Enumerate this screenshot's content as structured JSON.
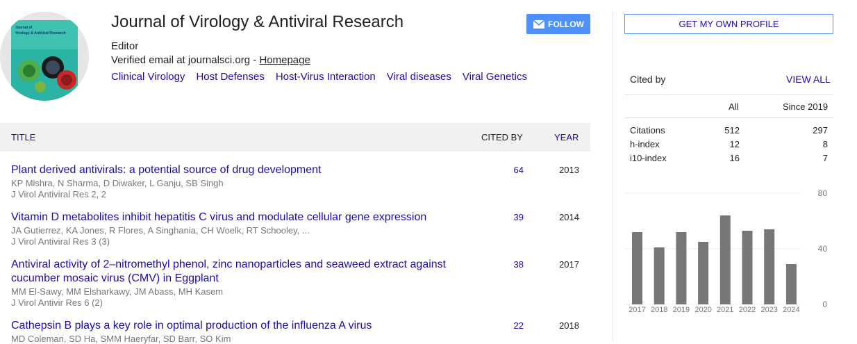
{
  "profile": {
    "name": "Journal of Virology & Antiviral Research",
    "affiliation": "Editor",
    "email_text": "Verified email at journalsci.org - ",
    "homepage_label": "Homepage",
    "interests": [
      "Clinical Virology",
      "Host Defenses",
      "Host-Virus Interaction",
      "Viral diseases",
      "Viral Genetics"
    ],
    "follow_label": "FOLLOW",
    "avatar_lines": [
      "Journal of",
      "Virology & Antiviral Research"
    ]
  },
  "table": {
    "headers": {
      "title": "TITLE",
      "cited_by": "CITED BY",
      "year": "YEAR"
    },
    "rows": [
      {
        "title": "Plant derived antivirals: a potential source of drug development",
        "authors": "KP Mishra, N Sharma, D Diwaker, L Ganju, SB Singh",
        "venue": "J Virol Antiviral Res 2, 2",
        "cited_by": "64",
        "year": "2013"
      },
      {
        "title": "Vitamin D metabolites inhibit hepatitis C virus and modulate cellular gene expression",
        "authors": "JA Gutierrez, KA Jones, R Flores, A Singhania, CH Woelk, RT Schooley, ...",
        "venue": "J Virol Antiviral Res 3 (3)",
        "cited_by": "39",
        "year": "2014"
      },
      {
        "title": "Antiviral activity of 2–nitromethyl phenol, zinc nanoparticles and seaweed extract against cucumber mosaic virus (CMV) in Eggplant",
        "authors": "MM El-Sawy, MM Elsharkawy, JM Abass, MH Kasem",
        "venue": "J Virol Antivir Res 6 (2)",
        "cited_by": "38",
        "year": "2017"
      },
      {
        "title": "Cathepsin B plays a key role in optimal production of the influenza A virus",
        "authors": "MD Coleman, SD Ha, SMM Haeryfar, SD Barr, SO Kim",
        "venue": "",
        "cited_by": "22",
        "year": "2018"
      }
    ]
  },
  "sidebar": {
    "profile_button": "GET MY OWN PROFILE",
    "cited_by_label": "Cited by",
    "view_all_label": "VIEW ALL",
    "col_all": "All",
    "col_since": "Since 2019",
    "stats": [
      {
        "label": "Citations",
        "all": "512",
        "since": "297"
      },
      {
        "label": "h-index",
        "all": "12",
        "since": "8"
      },
      {
        "label": "i10-index",
        "all": "16",
        "since": "7"
      }
    ]
  },
  "chart_data": {
    "type": "bar",
    "categories": [
      "2017",
      "2018",
      "2019",
      "2020",
      "2021",
      "2022",
      "2023",
      "2024"
    ],
    "values": [
      52,
      41,
      52,
      45,
      64,
      53,
      54,
      29
    ],
    "y_ticks": [
      "80",
      "40",
      "0"
    ],
    "ylim": [
      0,
      80
    ],
    "bar_color": "#777777"
  },
  "colors": {
    "link": "#1a0dab",
    "accent": "#4d90fe",
    "bar": "#777777"
  }
}
